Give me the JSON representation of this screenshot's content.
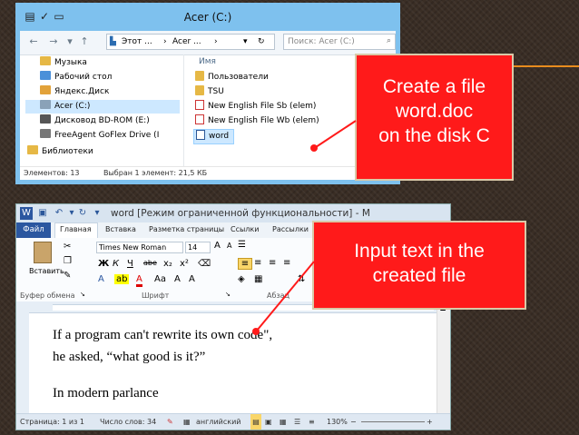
{
  "explorer": {
    "title": "Acer (C:)",
    "address": [
      "Этот ...",
      "Acer ..."
    ],
    "search_placeholder": "Поиск: Acer (C:)",
    "column_header": "Имя",
    "nav_items": [
      {
        "label": "Музыка",
        "icon": "music-folder-icon",
        "color": "#e6b845"
      },
      {
        "label": "Рабочий стол",
        "icon": "desktop-folder-icon",
        "color": "#4a90d9"
      },
      {
        "label": "Яндекс.Диск",
        "icon": "yandex-disk-icon",
        "color": "#e2a23a"
      },
      {
        "label": "Acer (C:)",
        "icon": "drive-icon",
        "color": "#8aa2b8",
        "selected": true
      },
      {
        "label": "Дисковод BD-ROM (E:)",
        "icon": "optical-drive-icon",
        "color": "#555555"
      },
      {
        "label": "FreeAgent GoFlex Drive (I",
        "icon": "external-drive-icon",
        "color": "#777777"
      },
      {
        "label": "Библиотеки",
        "icon": "libraries-icon",
        "color": "#e6b845"
      }
    ],
    "files": [
      {
        "label": "Пользователи",
        "icon": "folder-icon",
        "kind": "folder"
      },
      {
        "label": "TSU",
        "icon": "folder-icon",
        "kind": "folder"
      },
      {
        "label": "New English File Sb (elem)",
        "icon": "pdf-icon",
        "kind": "pdf"
      },
      {
        "label": "New English File Wb (elem)",
        "icon": "pdf-icon",
        "kind": "pdf"
      },
      {
        "label": "word",
        "icon": "word-doc-icon",
        "kind": "doc",
        "selected": true
      }
    ],
    "status": {
      "count": "Элементов: 13",
      "selection": "Выбран 1 элемент: 21,5 КБ"
    }
  },
  "word": {
    "title": "word [Режим ограниченной функциональности] - M",
    "file_tab": "Файл",
    "tabs": [
      "Главная",
      "Вставка",
      "Разметка страницы",
      "Ссылки",
      "Рассылки"
    ],
    "font_name": "Times New Roman",
    "font_size": "14",
    "paste_label": "Вставить",
    "group_labels": {
      "clipboard": "Буфер обмена",
      "font": "Шрифт",
      "paragraph": "Абзац"
    },
    "format_buttons": [
      "Ж",
      "К",
      "Ч",
      "abe",
      "x₂",
      "x²"
    ],
    "doc_lines": [
      "If a program can't rewrite its own code\",",
      "he asked, “what good is it?”",
      "In modern parlance"
    ],
    "status": {
      "page": "Страница: 1 из 1",
      "words": "Число слов: 34",
      "language": "английский",
      "zoom": "130%"
    }
  },
  "callouts": {
    "create_file": [
      "Create a file",
      "word.doc",
      "on the disk C"
    ],
    "input_text": [
      "Input text in the",
      "created file"
    ]
  },
  "colors": {
    "callout": "#ff1a1a",
    "accent": "#e88c1e",
    "explorer_frame": "#7ec1ee",
    "word_blue": "#2b57a0"
  }
}
